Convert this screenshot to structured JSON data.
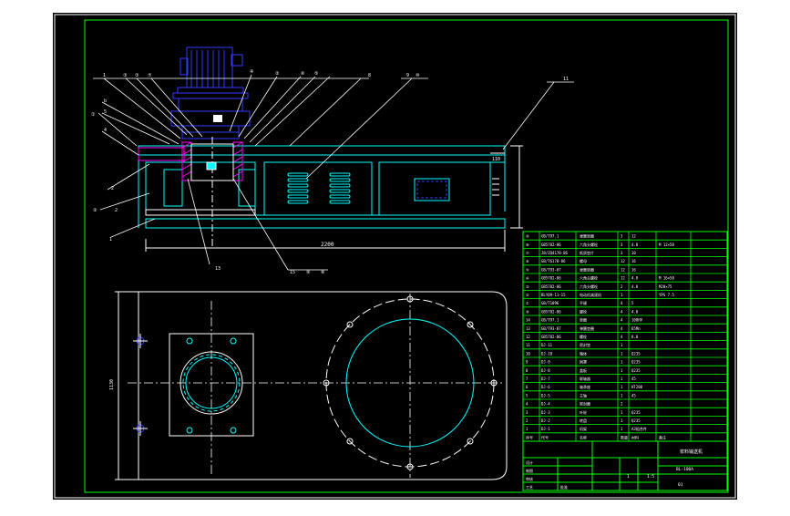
{
  "drawing": {
    "dimensions": {
      "overall_length": "2200",
      "height_right": "110",
      "plan_width": "1130"
    },
    "callouts_top": [
      "1",
      "③",
      "③",
      "⑦",
      "④",
      "②",
      "⑥",
      "⑤",
      "8",
      "9",
      "⑩",
      "11"
    ],
    "callouts_left": [
      "b",
      "5",
      "①",
      "4",
      "2",
      "②",
      "2",
      "1"
    ],
    "callouts_bottom": [
      "13",
      "15",
      "⑨",
      "⑧"
    ],
    "colors": {
      "background": "#000000",
      "frame": "#ffffff",
      "inner_border": "#00ff00",
      "outline": "#00ffff",
      "motor": "#2020ff",
      "centerline": "#ffffff",
      "hatch": "#ff00ff",
      "leader": "#ffffff"
    }
  },
  "bom": {
    "rows": [
      {
        "no": "⑨",
        "code": "GB/T97.1",
        "name": "弹簧垫圈",
        "qty": "3",
        "mat": "12",
        "note": ""
      },
      {
        "no": "⑧",
        "code": "GB5782-86",
        "name": "六角头螺栓",
        "qty": "3",
        "mat": "4.8",
        "note": "M 12×50"
      },
      {
        "no": "⑦",
        "code": "JB/ZQ4178-86",
        "name": "纸质垫片",
        "qty": "3",
        "mat": "10",
        "note": ""
      },
      {
        "no": "⑥",
        "code": "GB/T6170-86",
        "name": "螺母",
        "qty": "12",
        "mat": "16",
        "note": ""
      },
      {
        "no": "⑤",
        "code": "GB/T93-87",
        "name": "弹簧垫圈",
        "qty": "12",
        "mat": "16",
        "note": ""
      },
      {
        "no": "④",
        "code": "GB5782-86",
        "name": "六角头螺栓",
        "qty": "12",
        "mat": "4.8",
        "note": "M 16×50"
      },
      {
        "no": "③",
        "code": "GB5782-86",
        "name": "六角头螺栓",
        "qty": "2",
        "mat": "4.8",
        "note": "M20×75"
      },
      {
        "no": "②",
        "code": "BLY09-11-15",
        "name": "电动机减速机",
        "qty": "1",
        "mat": "",
        "note": "YPS 7.5"
      },
      {
        "no": "①",
        "code": "GB/T1096",
        "name": "平键",
        "qty": "4",
        "mat": "5",
        "note": ""
      },
      {
        "no": "⑩",
        "code": "GB5782-86",
        "name": "螺栓",
        "qty": "4",
        "mat": "4.8",
        "note": ""
      },
      {
        "no": "14",
        "code": "GB/T97.1",
        "name": "垫圈",
        "qty": "4",
        "mat": "100HV",
        "note": ""
      },
      {
        "no": "13",
        "code": "GB/T93-87",
        "name": "弹簧垫圈",
        "qty": "4",
        "mat": "65Mn",
        "note": ""
      },
      {
        "no": "12",
        "code": "GB5782-86",
        "name": "螺栓",
        "qty": "4",
        "mat": "8.8",
        "note": ""
      },
      {
        "no": "11",
        "code": "DJ-11",
        "name": "密封垫",
        "qty": "1",
        "mat": "",
        "note": ""
      },
      {
        "no": "10",
        "code": "DJ-10",
        "name": "箱体",
        "qty": "1",
        "mat": "Q235",
        "note": ""
      },
      {
        "no": "9",
        "code": "DJ-9",
        "name": "网罩",
        "qty": "1",
        "mat": "Q235",
        "note": ""
      },
      {
        "no": "8",
        "code": "DJ-8",
        "name": "盖板",
        "qty": "1",
        "mat": "Q235",
        "note": ""
      },
      {
        "no": "7",
        "code": "DJ-7",
        "name": "联轴器",
        "qty": "1",
        "mat": "45",
        "note": ""
      },
      {
        "no": "6",
        "code": "DJ-6",
        "name": "轴承座",
        "qty": "1",
        "mat": "HT200",
        "note": ""
      },
      {
        "no": "5",
        "code": "DJ-5",
        "name": "主轴",
        "qty": "1",
        "mat": "45",
        "note": ""
      },
      {
        "no": "4",
        "code": "DJ-4",
        "name": "密封圈",
        "qty": "2",
        "mat": "",
        "note": ""
      },
      {
        "no": "3",
        "code": "DJ-3",
        "name": "叶轮",
        "qty": "1",
        "mat": "Q235",
        "note": ""
      },
      {
        "no": "2",
        "code": "DJ-2",
        "name": "转盘",
        "qty": "1",
        "mat": "Q235",
        "note": ""
      },
      {
        "no": "1",
        "code": "DJ-1",
        "name": "机架",
        "qty": "1",
        "mat": "A3组合件",
        "note": ""
      }
    ],
    "header": [
      "序号",
      "代号",
      "名称",
      "数量",
      "材料",
      "备注"
    ]
  },
  "titleblock": {
    "title": "浆料输送机",
    "code": "BL-100A",
    "sheet": "01",
    "scale": "1:5",
    "qty": "1",
    "labels": [
      "设计",
      "制图",
      "审核",
      "工艺",
      "批准"
    ]
  }
}
